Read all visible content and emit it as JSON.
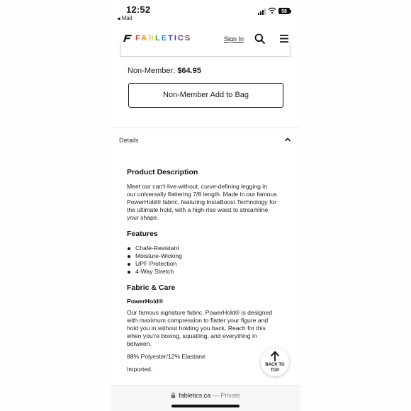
{
  "status_bar": {
    "time": "12:52",
    "back_label": "Mail",
    "battery": "58"
  },
  "header": {
    "logo_text": "FABLETICS",
    "signin_label": "Sign In"
  },
  "product": {
    "nonmember_label": "Non-Member:",
    "nonmember_price": "$64.95",
    "add_to_bag_label": "Non-Member Add to Bag"
  },
  "details": {
    "section_label": "Details",
    "description_heading": "Product Description",
    "description_lines": [
      "Meet our can't-live-without, curve-defining legging in",
      "our universally flattering 7/8 length. Made in our famous",
      "PowerHold® fabric, featuring InstaBoost Technology for",
      "the ultimate hold, with a high-rise waist to streamline",
      "your shape."
    ],
    "features_heading": "Features",
    "features": [
      "Chafe-Resistant",
      "Moisture-Wicking",
      "UPF Protection",
      "4-Way Stretch"
    ],
    "fabric_heading": "Fabric & Care",
    "fabric_subheading": "PowerHold®",
    "fabric_lines": [
      "Our famous signature fabric, PowerHold® is designed",
      "with maximum compression to flatter your figure and",
      "hold you in without holding you back. Reach for this",
      "when you're boxing, squatting, and everything in",
      "between."
    ],
    "composition": "88% Polyester/12% Elastane",
    "origin": "Imported."
  },
  "back_to_top": {
    "line1": "BACK TO",
    "line2": "TOP"
  },
  "url_bar": {
    "domain": "fabletics.ca",
    "separator": "—",
    "mode": "Private"
  },
  "icons": [
    "signal-icon",
    "wifi-icon",
    "battery-icon",
    "logo-icon",
    "search-icon",
    "menu-icon",
    "chevron-up-icon",
    "arrow-up-icon",
    "lock-icon"
  ]
}
